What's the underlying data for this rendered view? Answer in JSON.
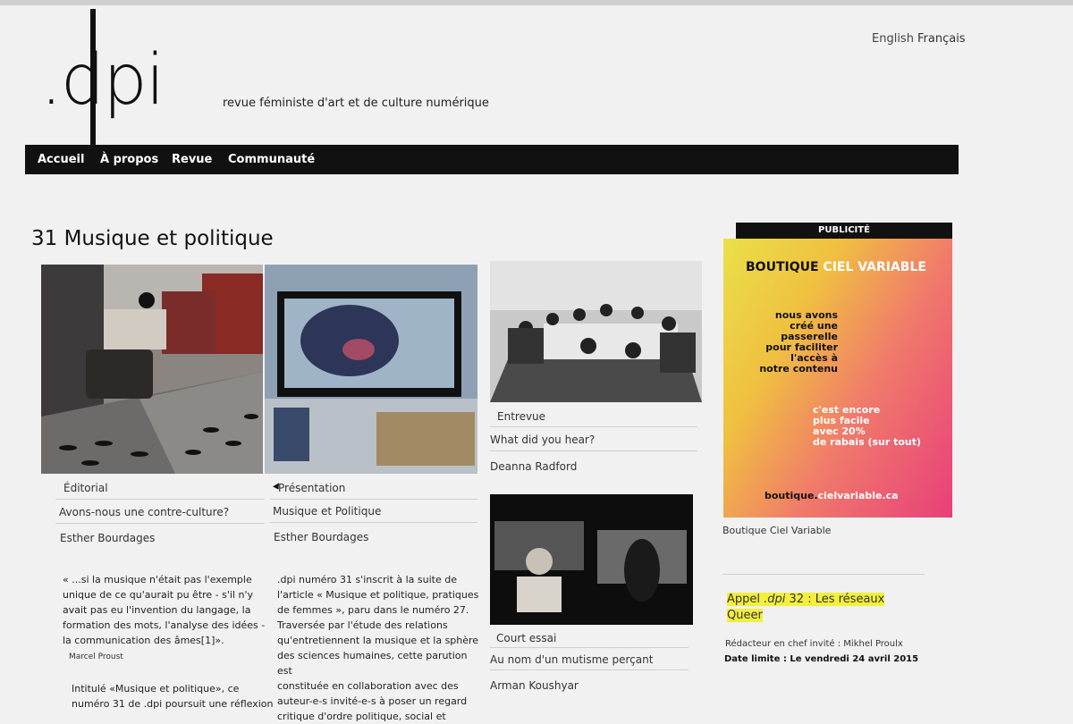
{
  "site": {
    "logo": ".dpi",
    "tagline": "revue féministe d'art et de culture numérique",
    "languages": [
      "English",
      "Français"
    ]
  },
  "nav": {
    "items": [
      "Accueil",
      "À propos",
      "Revue",
      "Communauté"
    ]
  },
  "page": {
    "title": "31 Musique et politique"
  },
  "cards": [
    {
      "category": "Éditorial",
      "heading": "Avons-nous une contre-culture?",
      "author": "Esther Bourdages"
    },
    {
      "category": "Présentation",
      "heading": "Musique et Politique",
      "author": "Esther Bourdages"
    },
    {
      "category": "Entrevue",
      "heading": "What did you hear?",
      "author": "Deanna Radford"
    },
    {
      "category": "Court essai",
      "heading": "Au nom d'un mutisme perçant",
      "author": "Arman Koushyar"
    }
  ],
  "quote": {
    "lines": [
      "« ...si la musique n'était pas l'exemple",
      "unique de ce qu'aurait pu être - s'il n'y",
      "avait pas eu l'invention du langage, la",
      "formation des mots, l'analyse des idées -",
      "la communication des âmes[1]»."
    ],
    "author": "Marcel Proust",
    "continuation": [
      "Intitulé «Musique et politique», ce",
      "numéro 31 de .dpi poursuit une réflexion"
    ]
  },
  "intro": {
    "lines": [
      ".dpi numéro 31 s'inscrit à la suite de",
      "l'article « Musique et politique, pratiques",
      "de femmes », paru dans le numéro 27.",
      "Traversée par l'étude des relations",
      "qu'entretiennent la musique et la sphère",
      "des sciences humaines, cette parution est",
      "constituée en collaboration avec des",
      "auteur-e-s invité-e-s à poser un regard",
      "critique d'ordre politique, social et"
    ]
  },
  "sidebar": {
    "ad_label": "PUBLICITÉ",
    "ad_brand": "BOUTIQUE",
    "ad_brand_accent": "CIEL VARIABLE",
    "ad_text1": [
      "nous avons",
      "créé une",
      "passerelle",
      "pour faciliter",
      "l'accès à",
      "notre contenu"
    ],
    "ad_text2": [
      "c'est encore",
      "plus facile",
      "avec 20%",
      "de rabais (sur tout)"
    ],
    "ad_url_a": "boutique.",
    "ad_url_b": "cielvariable.ca",
    "ad_caption": "Boutique Ciel Variable",
    "call_title_a": "Appel ",
    "call_title_b": ".dpi",
    "call_title_c": " 32 : Les réseaux",
    "call_title_d": "Queer",
    "editor": "Rédacteur en chef invité : Mikhel Proulx",
    "deadline": "Date limite : Le vendredi 24 avril 2015"
  },
  "colors": {
    "nav_bg": "#111111",
    "highlight": "#f3ef3b",
    "ad_gradient_start": "#eae04a",
    "ad_gradient_end": "#e83f7a"
  }
}
